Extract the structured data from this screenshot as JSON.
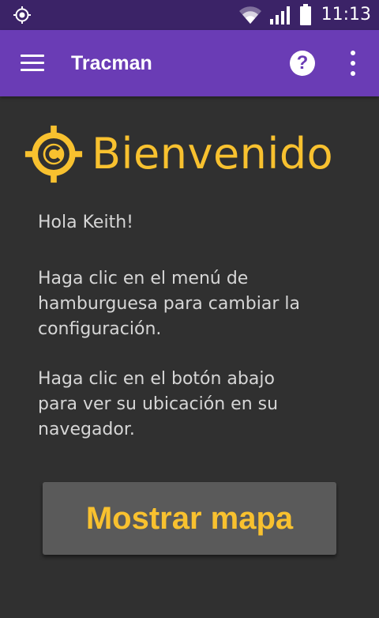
{
  "status_bar": {
    "time": "11:13",
    "left_icon": "crosshair-icon",
    "icons": [
      "wifi-icon",
      "signal-icon",
      "battery-icon"
    ]
  },
  "app_bar": {
    "title": "Tracman",
    "menu_icon": "hamburger-menu-icon",
    "help_icon": "help-icon",
    "help_glyph": "?",
    "overflow_icon": "overflow-menu-icon"
  },
  "main": {
    "welcome_title": "Bienvenido",
    "greeting": "Hola Keith!",
    "instruction_menu": "Haga clic en el menú de\nhamburguesa para cambiar la\nconfiguración.",
    "instruction_button": "Haga clic en el botón abajo\npara ver su ubicación en su\nnavegador.",
    "map_button_label": "Mostrar mapa"
  },
  "colors": {
    "status_bar": "#3b2367",
    "app_bar": "#6a3cb5",
    "background": "#303030",
    "accent": "#f8c12f",
    "body_text": "#d6d6d6",
    "button_bg": "#5a5a5a"
  }
}
